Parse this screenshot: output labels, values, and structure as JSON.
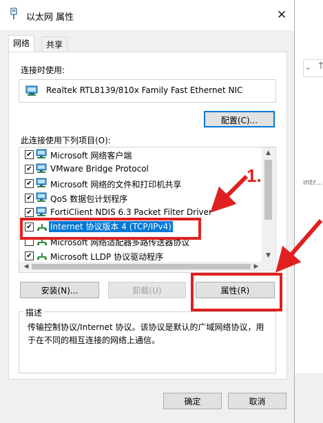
{
  "window": {
    "title": "以太网 属性",
    "close_glyph": "✕"
  },
  "tabs": [
    {
      "label": "网络"
    },
    {
      "label": "共享"
    }
  ],
  "connect_using_label": "连接时使用:",
  "adapter_name": "Realtek RTL8139/810x Family Fast Ethernet NIC",
  "configure_button": "配置(C)...",
  "items_label": "此连接使用下列项目(O):",
  "items": [
    {
      "label": "Microsoft 网络客户端",
      "checked": true,
      "icon": "network-icon"
    },
    {
      "label": "VMware Bridge Protocol",
      "checked": true,
      "icon": "network-icon"
    },
    {
      "label": "Microsoft 网络的文件和打印机共享",
      "checked": true,
      "icon": "network-icon"
    },
    {
      "label": "QoS 数据包计划程序",
      "checked": true,
      "icon": "network-icon"
    },
    {
      "label": "FortiClient NDIS 6.3 Packet Filter Driver",
      "checked": true,
      "icon": "network-icon"
    },
    {
      "label": "Internet 协议版本 4 (TCP/IPv4)",
      "checked": true,
      "icon": "protocol-icon",
      "selected": true
    },
    {
      "label": "Microsoft 网络适配器多路传送器协议",
      "checked": false,
      "icon": "protocol-icon"
    },
    {
      "label": "Microsoft LLDP 协议驱动程序",
      "checked": true,
      "icon": "protocol-icon"
    }
  ],
  "buttons": {
    "install": "安装(N)...",
    "uninstall": "卸载(U)",
    "properties": "属性(R)",
    "ok": "确定",
    "cancel": "取消"
  },
  "description": {
    "title": "描述",
    "text": "传输控制协议/Internet 协议。该协议是默认的广域网络协议，用于在不同的相互连接的网络上通信。"
  },
  "annotation": {
    "step_label": "1."
  },
  "background_window": {
    "snippet": "ıntr..."
  },
  "colors": {
    "accent": "#0078d7",
    "annotation_red": "#e02020",
    "disabled_text": "#9e9e9e"
  }
}
